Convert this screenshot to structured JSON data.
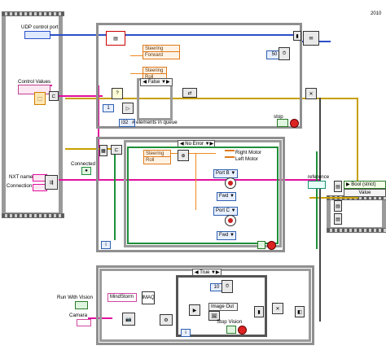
{
  "year_label": "2010",
  "controls": {
    "udp_port": "UDP control port",
    "control_values": "Control Values",
    "nxt_name": "NXT name",
    "connection": "Connection",
    "connected": "Connected",
    "run_with_vision": "Run With Vision",
    "camera": "Camara",
    "reference": "reference"
  },
  "top_loop": {
    "cluster_items": [
      "Steering",
      "Forward"
    ],
    "bundle_items": [
      "Steering",
      "Roll"
    ],
    "case_selector": "False",
    "timer_value": "50",
    "elements_label": "# elements in queue",
    "index_value": "1",
    "i32_label": "I32",
    "stop_label": "stop"
  },
  "middle_loop": {
    "case_selector": "No Error",
    "unbundle_items": [
      "Steering",
      "Roll"
    ],
    "motor_labels": [
      "Right Motor",
      "Left Motor"
    ],
    "port_b": "Port B",
    "port_c": "Port C",
    "direction_b": "Fwd",
    "direction_c": "Fwd",
    "iteration": "i"
  },
  "bottom_case": {
    "case_selector": "True",
    "mindstorm": "MindStorm",
    "imaq": "IMAQ",
    "image_out": "Image Out",
    "stop_vision": "Stop Vision",
    "timer_value": "10",
    "iteration": "i"
  },
  "right_panel": {
    "bool_strict": "Bool (strict)",
    "value": "Value"
  }
}
